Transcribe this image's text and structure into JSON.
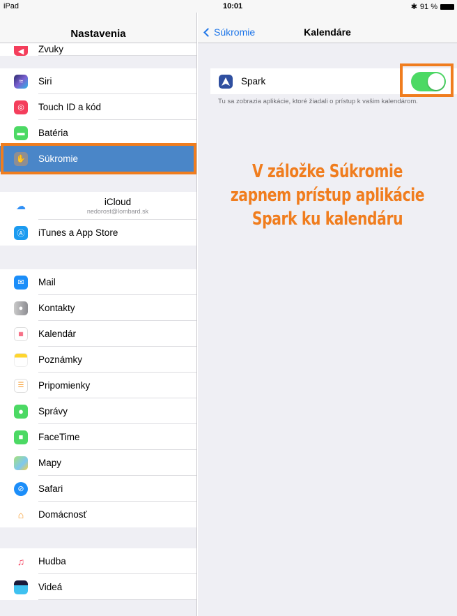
{
  "status": {
    "device": "iPad",
    "time": "10:01",
    "battery": "91 %"
  },
  "left_nav": {
    "title": "Nastavenia"
  },
  "sidebar": {
    "items": [
      {
        "label": "Zvuky",
        "icon": "speaker-icon",
        "color": "#f43e5c"
      },
      {
        "label": "Siri",
        "icon": "siri-icon",
        "color": "#3a3a8c"
      },
      {
        "label": "Touch ID a kód",
        "icon": "fingerprint-icon",
        "color": "#f43e5c"
      },
      {
        "label": "Batéria",
        "icon": "battery-icon",
        "color": "#4cd964"
      },
      {
        "label": "Súkromie",
        "icon": "hand-icon",
        "color": "#8e8e93"
      },
      {
        "label": "iCloud",
        "sub": "nedorost@lombard.sk",
        "icon": "icloud-icon",
        "color": "#ffffff"
      },
      {
        "label": "iTunes a App Store",
        "icon": "app-store-icon",
        "color": "#1c9bf0"
      },
      {
        "label": "Mail",
        "icon": "mail-icon",
        "color": "#1c8ef9"
      },
      {
        "label": "Kontakty",
        "icon": "contacts-icon",
        "color": "#8e8e93"
      },
      {
        "label": "Kalendár",
        "icon": "calendar-icon",
        "color": "#ffffff"
      },
      {
        "label": "Poznámky",
        "icon": "notes-icon",
        "color": "#fed52e"
      },
      {
        "label": "Pripomienky",
        "icon": "reminders-icon",
        "color": "#ffffff"
      },
      {
        "label": "Správy",
        "icon": "messages-icon",
        "color": "#4cd964"
      },
      {
        "label": "FaceTime",
        "icon": "facetime-icon",
        "color": "#4cd964"
      },
      {
        "label": "Mapy",
        "icon": "maps-icon",
        "color": "#7ec7f0"
      },
      {
        "label": "Safari",
        "icon": "safari-icon",
        "color": "#1c8ef9"
      },
      {
        "label": "Domácnosť",
        "icon": "home-icon",
        "color": "#ffffff"
      },
      {
        "label": "Hudba",
        "icon": "music-icon",
        "color": "#ffffff"
      },
      {
        "label": "Videá",
        "icon": "videos-icon",
        "color": "#1a1a3a"
      }
    ]
  },
  "right_nav": {
    "back_label": "Súkromie",
    "title": "Kalendáre"
  },
  "app_row": {
    "label": "Spark",
    "toggle_on": true,
    "accent": "#4cd964"
  },
  "footer_note": "Tu sa zobrazia aplikácie, ktoré žiadali o prístup k vašim kalendárom.",
  "annotation": {
    "line1": "V záložke Súkromie",
    "line2": "zapnem prístup aplikácie",
    "line3": "Spark ku kalendáru",
    "color": "#f07d1e"
  }
}
